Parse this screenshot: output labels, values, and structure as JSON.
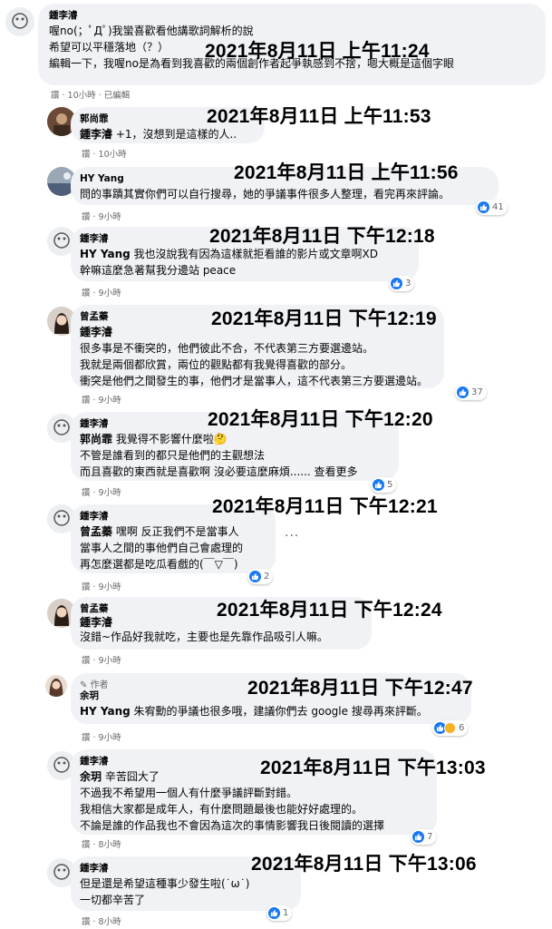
{
  "comments": [
    {
      "name": "鍾李濬",
      "lines": [
        "喔no(；ﾟДﾟ)我蠻喜歡看他講歌詞解析的說",
        "希望可以平穩落地（？）",
        "編輯一下，我喔no是為看到我喜歡的兩個創作者起爭執感到不捨，嗯大概是這個字眼"
      ],
      "meta": "讚 · 10小時 · 已編輯",
      "stamp": "2021年8月11日 上午11:24"
    },
    {
      "name": "郭尚霏",
      "mention": "鍾李濬",
      "lines": [
        " +1，沒想到是這樣的人.."
      ],
      "meta": "讚 · 10小時",
      "stamp": "2021年8月11日 上午11:53"
    },
    {
      "name": "HY Yang",
      "lines": [
        "問的事蹟其實你們可以自行搜尋，她的爭議事件很多人整理，看完再來評論。"
      ],
      "meta": "讚 · 9小時",
      "reactions": "41",
      "stamp": "2021年8月11日 上午11:56"
    },
    {
      "name": "鍾李濬",
      "mention": "HY Yang",
      "lines": [
        " 我也沒說我有因為這樣就拒看誰的影片或文章啊XD",
        "幹嘛這麼急著幫我分邊站 peace"
      ],
      "meta": "讚 · 9小時",
      "reactions": "3",
      "stamp": "2021年8月11日 下午12:18"
    },
    {
      "name": "曾孟蓁",
      "mention": "鍾李濬",
      "lines": [
        "很多事是不衝突的，他們彼此不合，不代表第三方要選邊站。",
        "我就是兩個都欣賞，兩位的觀點都有我覺得喜歡的部分。",
        "衝突是他們之間發生的事，他們才是當事人，這不代表第三方要選邊站。"
      ],
      "meta": "讚 · 9小時",
      "reactions": "37",
      "stamp": "2021年8月11日 下午12:19"
    },
    {
      "name": "鍾李濬",
      "mention": "郭尚霏",
      "lines": [
        " 我覺得不影響什麼啦🤔",
        "不管是誰看到的都只是他們的主觀想法",
        "而且喜歡的東西就是喜歡啊 沒必要這麼麻煩...... 查看更多"
      ],
      "meta": "讚 · 9小時",
      "reactions": "5",
      "stamp": "2021年8月11日 下午12:20"
    },
    {
      "name": "鍾李濬",
      "mention": "曾孟蓁",
      "lines": [
        " 嘿啊 反正我們不是當事人",
        "當事人之間的事他們自己會處理的",
        "再怎麼選都是吃瓜看戲的(￣▽￣)"
      ],
      "meta": "讚 · 9小時",
      "reactions": "2",
      "more": "···",
      "stamp": "2021年8月11日 下午12:21"
    },
    {
      "name": "曾孟蓁",
      "mention": "鍾李濬",
      "lines": [
        "沒錯~作品好我就吃，主要也是先靠作品吸引人嘛。"
      ],
      "meta": "讚 · 9小時",
      "stamp": "2021年8月11日 下午12:24"
    },
    {
      "author": "作者",
      "name": "余玥",
      "mention": "HY Yang",
      "lines": [
        " 朱宥勳的爭議也很多哦，建議你們去 google 搜尋再來評斷。"
      ],
      "meta": "讚 · 9小時",
      "reactions": "6",
      "stamp": "2021年8月11日 下午12:47"
    },
    {
      "name": "鍾李濬",
      "mention": "余玥",
      "lines": [
        " 辛苦囧大了",
        "不過我不希望用一個人有什麼爭議評斷對錯。",
        "我相信大家都是成年人，有什麼問題最後也能好好處理的。",
        "不論是誰的作品我也不會因為這次的事情影響我日後閱讀的選擇"
      ],
      "meta": "讚 · 8小時",
      "reactions": "7",
      "stamp": "2021年8月11日 下午13:03"
    },
    {
      "name": "鍾李濬",
      "lines": [
        "但是還是希望這種事少發生啦(˙ω˙)",
        "一切都辛苦了"
      ],
      "meta": "讚 · 8小時",
      "reactions": "1",
      "stamp": "2021年8月11日 下午13:06"
    }
  ]
}
